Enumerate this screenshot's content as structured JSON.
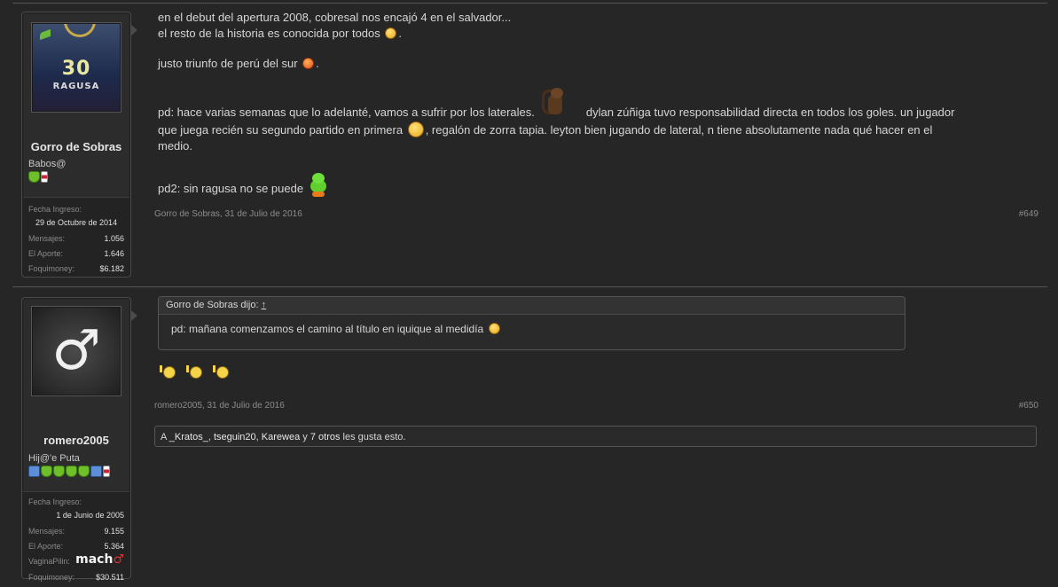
{
  "posts": [
    {
      "user": {
        "name": "Gorro de Sobras",
        "title": "Babos@",
        "avatar_text": {
          "number": "30",
          "name": "RAGUSA"
        },
        "badges": [
          "green-shield",
          "flag"
        ],
        "stats": {
          "join_label": "Fecha Ingreso:",
          "join_value": "29 de Octubre de 2014",
          "messages_label": "Mensajes:",
          "messages_value": "1.056",
          "aporte_label": "El Aporte:",
          "aporte_value": "1.646",
          "money_label": "Foquimoney:",
          "money_value": "$6.182"
        }
      },
      "lines": {
        "l1": "en el debut del apertura 2008, cobresal nos encajó 4 en el salvador...",
        "l2": "el resto de la historia es conocida por todos",
        "l2_end": ".",
        "l3": "justo triunfo de perú del sur",
        "l3_end": ".",
        "l4a": "pd: hace varias semanas que lo adelanté, vamos a sufrir por los laterales.",
        "l4b": "dylan zúñiga tuvo responsabilidad directa en todos los goles. un jugador",
        "l5a": "que juega recién su segundo partido en primera",
        "l5b": ", regalón de zorra tapia. leyton bien jugando de lateral, n tiene absolutamente nada qué hacer en el",
        "l6": "medio.",
        "l7": "pd2: sin ragusa no se puede"
      },
      "meta": "Gorro de Sobras, 31 de Julio de 2016",
      "number": "#649"
    },
    {
      "user": {
        "name": "romero2005",
        "title": "Hij@'e Puta",
        "avatar_symbol": "♂",
        "badges": [
          "blue-shield",
          "green-shield",
          "green-shield",
          "green-shield",
          "green-shield",
          "blue-shield",
          "flag"
        ],
        "stats": {
          "join_label": "Fecha Ingreso:",
          "join_value": "1 de Junio de 2005",
          "messages_label": "Mensajes:",
          "messages_value": "9.155",
          "aporte_label": "El Aporte:",
          "aporte_value": "5.364",
          "vp_label": "VaginaPilin:",
          "vp_value": "mach",
          "vp_symbol": "♂",
          "money_label": "Foquimoney:",
          "money_value": "$30.511"
        }
      },
      "quote": {
        "author_line": "Gorro de Sobras dijo:",
        "link": "↑",
        "text": "pd: mañana comenzamos el camino al título en iquique al medidía"
      },
      "meta": "romero2005, 31 de Julio de 2016",
      "number": "#650",
      "likes": {
        "prefix": "A",
        "users": [
          "_Kratos_",
          "tseguin20",
          "Karewea"
        ],
        "sep1": ",",
        "sep2": ",",
        "and": "y",
        "others": "7 otros",
        "suffix": "les gusta esto."
      }
    }
  ]
}
